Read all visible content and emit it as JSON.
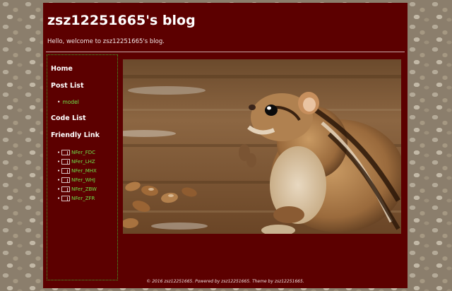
{
  "site": {
    "title": "zsz12251665's blog",
    "tagline": "Hello, welcome to zsz12251665's blog."
  },
  "sidebar": {
    "home": "Home",
    "post_list_heading": "Post List",
    "posts": [
      "model"
    ],
    "code_list_heading": "Code List",
    "friendly_link_heading": "Friendly Link",
    "friends": [
      "NFer_FDC",
      "NFer_LHZ",
      "NFer_MHX",
      "NFer_WHJ",
      "NFer_ZBW",
      "NFer_ZFR"
    ]
  },
  "hero_image": {
    "subject": "chipmunk-with-almonds-photo"
  },
  "footer": {
    "text": "© 2016 zsz12251665. Powered by zsz12251665. Theme by zsz12251665."
  },
  "colors": {
    "page_background": "#8b7e6c",
    "content_background": "#5c0000",
    "link_green": "#6ee04a",
    "sidebar_border": "#3fae2a"
  }
}
